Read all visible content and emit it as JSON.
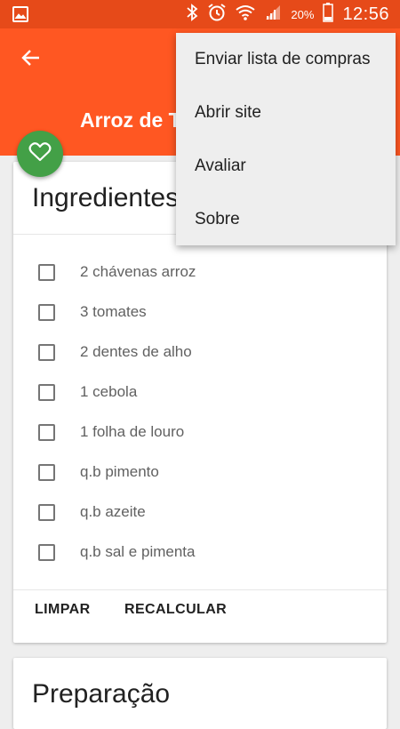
{
  "status_bar": {
    "battery_percent": "20%",
    "time": "12:56",
    "icons": [
      "image-icon",
      "bluetooth-icon",
      "alarm-icon",
      "wifi-icon",
      "signal-icon",
      "battery-icon"
    ]
  },
  "toolbar": {
    "title": "Arroz de T",
    "back_icon": "arrow-back-icon"
  },
  "fab": {
    "icon": "heart-icon",
    "color": "#43a047"
  },
  "ingredients": {
    "title": "Ingredientes",
    "items": [
      {
        "label": "2 chávenas arroz",
        "checked": false
      },
      {
        "label": "3 tomates",
        "checked": false
      },
      {
        "label": "2 dentes de alho",
        "checked": false
      },
      {
        "label": "1 cebola",
        "checked": false
      },
      {
        "label": "1 folha de louro",
        "checked": false
      },
      {
        "label": "q.b pimento",
        "checked": false
      },
      {
        "label": "q.b azeite",
        "checked": false
      },
      {
        "label": "q.b sal e pimenta",
        "checked": false
      }
    ],
    "actions": {
      "clear": "LIMPAR",
      "recalculate": "RECALCULAR"
    }
  },
  "preparation": {
    "title": "Preparação"
  },
  "overflow_menu": {
    "items": [
      {
        "label": "Enviar lista de compras"
      },
      {
        "label": "Abrir site"
      },
      {
        "label": "Avaliar"
      },
      {
        "label": "Sobre"
      }
    ]
  },
  "colors": {
    "status_bar": "#e64a19",
    "toolbar": "#ff5722",
    "fab": "#43a047",
    "background": "#eeeeee"
  }
}
